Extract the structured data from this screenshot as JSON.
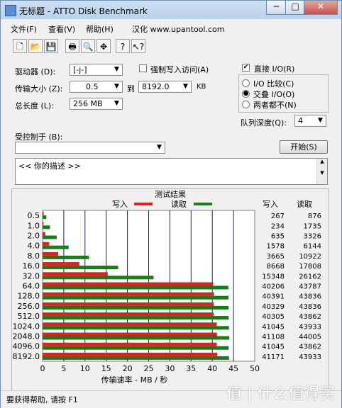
{
  "window": {
    "title": "无标题 - ATTO Disk Benchmark",
    "minimize": "─",
    "maximize": "□",
    "close": "✕"
  },
  "menu": {
    "file": "文件(F)",
    "view": "查看(V)",
    "help": "帮助(H)",
    "credit": "汉化 www.upantool.com"
  },
  "toolbar": {
    "icons": [
      "new-icon",
      "open-icon",
      "save-icon",
      "print-icon",
      "print-preview-icon",
      "move-icon",
      "help-icon",
      "context-help-icon"
    ]
  },
  "settings": {
    "drive_label": "驱动器 (D):",
    "drive_value": "[-j-]",
    "force_write_label": "强制写入访问(A)",
    "force_write_checked": false,
    "transfer_size_label": "传输大小 (Z):",
    "transfer_from": "0.5",
    "to_label": "到",
    "transfer_to": "8192.0",
    "transfer_unit": "KB",
    "total_length_label": "总长度 (L):",
    "total_length_value": "256 MB",
    "direct_io_label": "直接 I/O(R)",
    "direct_io_checked": true,
    "io_compare_label": "I/O 比较(C)",
    "overlap_io_label": "交叠 I/O(O)",
    "neither_label": "两者都不(N)",
    "io_mode_selected": "overlap",
    "queue_depth_label": "队列深度(Q):",
    "queue_depth_value": "4",
    "controlled_by_label": "受控制于 (B):",
    "controlled_by_value": "",
    "start_button": "开始(S)",
    "description": "<<  你的描述   >>"
  },
  "chart_data": {
    "type": "bar",
    "title": "测试结果",
    "legend": [
      {
        "name": "写入",
        "color": "#e02020"
      },
      {
        "name": "读取",
        "color": "#108010"
      }
    ],
    "legend_placement": "top",
    "categories": [
      "0.5",
      "1.0",
      "2.0",
      "4.0",
      "8.0",
      "16.0",
      "32.0",
      "64.0",
      "128.0",
      "256.0",
      "512.0",
      "1024.0",
      "2048.0",
      "4096.0",
      "8192.0"
    ],
    "series": [
      {
        "name": "写入",
        "values": [
          267,
          234,
          635,
          1578,
          3665,
          8668,
          15348,
          40206,
          40391,
          40329,
          40305,
          41045,
          41108,
          41045,
          41171
        ],
        "color": "#e02020"
      },
      {
        "name": "读取",
        "values": [
          876,
          1735,
          3326,
          6144,
          10922,
          17808,
          26162,
          43787,
          43836,
          43836,
          43862,
          43933,
          44005,
          43862,
          43933
        ],
        "color": "#108010"
      }
    ],
    "value_unit_scale": 0.001,
    "xlabel": "传输速率 - MB / 秒",
    "xticks": [
      "0",
      "5",
      "10",
      "15",
      "20",
      "25",
      "30",
      "35",
      "40",
      "45",
      "50"
    ],
    "xlim": [
      0,
      50
    ],
    "grid": true,
    "table_headers": [
      "写入",
      "读取"
    ]
  },
  "status": {
    "text": "要获得帮助, 请按 F1",
    "watermark": "值 | 什么值得买"
  }
}
